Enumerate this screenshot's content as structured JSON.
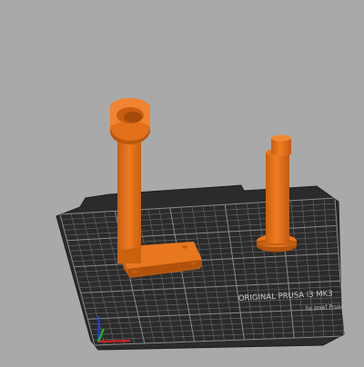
{
  "viewport": {
    "background_color": "#a9a9a9",
    "bed_color": "#2b2b2b",
    "grid_color": "#707070",
    "model_color": "#e8741c",
    "model_shadow_color": "#b0560e",
    "model_highlight_color": "#f3923e"
  },
  "bed": {
    "brand_line1": "ORIGINAL PRUSA i3 MK3",
    "brand_line2": "by Josef Prusa"
  },
  "axes": {
    "x_color": "#e02020",
    "y_color": "#20c020",
    "z_color": "#2040e0"
  }
}
